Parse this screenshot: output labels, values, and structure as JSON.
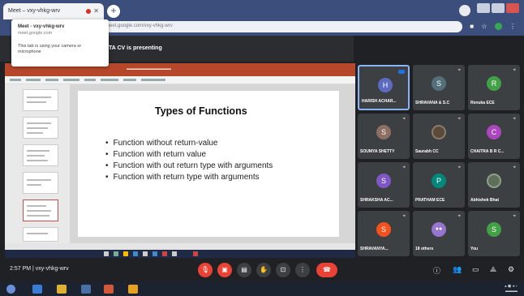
{
  "browser": {
    "tab_title": "Meet – vxy-vhkg-wrv",
    "url": "meet.google.com/vxy-vhkg-wrv",
    "tooltip": {
      "title": "Meet - vxy-vhkg-wrv",
      "domain": "meet.google.com",
      "note": "This tab is using your camera or microphone"
    }
  },
  "meeting": {
    "presenting_text": "TA CV is presenting",
    "time": "2:57 PM",
    "meeting_code": "vxy-vhkg-wrv"
  },
  "slide": {
    "title": "Types of Functions",
    "bullets": [
      "Function without return-value",
      "Function with return value",
      "Function with out return type with arguments",
      "Function with return type with arguments"
    ]
  },
  "participants": [
    {
      "initial": "H",
      "name": "HARISH ACHAR...",
      "color": "#5c6bc0"
    },
    {
      "initial": "S",
      "name": "SHRAVANA & S.C",
      "color": "#546e7a"
    },
    {
      "initial": "R",
      "name": "Renuka ECE",
      "color": "#43a047"
    },
    {
      "initial": "S",
      "name": "SOUMYA SHETTY",
      "color": "#8d6e63"
    },
    {
      "initial": "",
      "name": "Saurabh CC",
      "color": "#5a4a3a"
    },
    {
      "initial": "C",
      "name": "CHAITRA B R C...",
      "color": "#ab47bc"
    },
    {
      "initial": "S",
      "name": "SHRAKSHA AC...",
      "color": "#7e57c2"
    },
    {
      "initial": "P",
      "name": "PRATHAM ECE",
      "color": "#00897b"
    },
    {
      "initial": "",
      "name": "Abhishek Bhat",
      "color": "#5f6f5a"
    },
    {
      "initial": "S",
      "name": "SHRAVANYA...",
      "color": "#f4511e"
    },
    {
      "initial": "",
      "name": "18 others",
      "color": "#9575cd"
    },
    {
      "initial": "S",
      "name": "You",
      "color": "#43a047"
    }
  ],
  "icons": {
    "mic": "mic-off-icon",
    "cam": "camera-off-icon",
    "captions": "captions-icon",
    "hand": "raise-hand-icon",
    "present": "present-icon",
    "more": "more-options-icon",
    "end": "end-call-icon"
  },
  "colors": {
    "danger": "#ea4335",
    "accent": "#8ab4f8"
  }
}
